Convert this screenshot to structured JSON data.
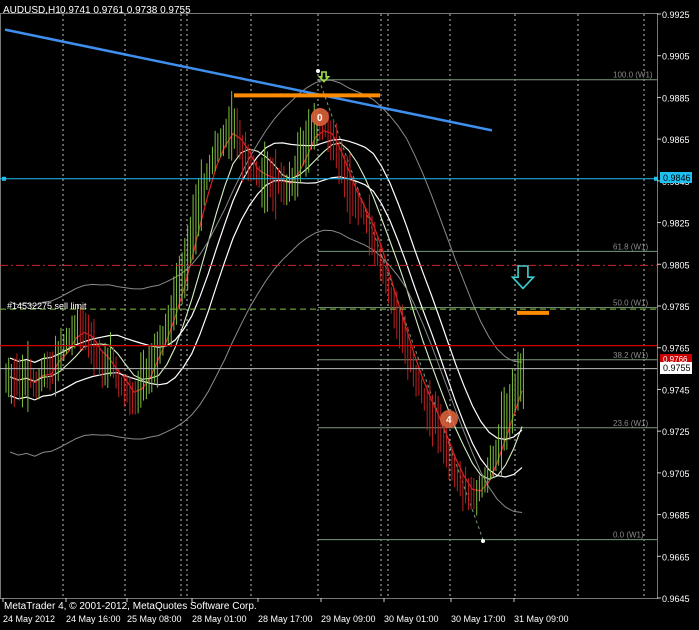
{
  "header": {
    "symbol_tf": "AUDUSD,H1",
    "ohlc": "0.9741 0.9761 0.9738 0.9755"
  },
  "footer": {
    "copyright": "MetaTrader 4, © 2001-2012, MetaQuotes Software Corp."
  },
  "order_label": "#14532275 sell limit",
  "price_badges": {
    "hline": "0.9846",
    "red": "0.9766",
    "current": "0.9755"
  },
  "colors": {
    "background": "#000000",
    "grid": "#ffffff",
    "bull": "#7fbf3f",
    "bear": "#c02020",
    "trendline": "#3f8fef",
    "hline": "#1fbfef",
    "level": "#ff8c00",
    "fibo": "#7a9a7a",
    "red_line": "#cc0000",
    "green_dash": "#7fbf3f",
    "arrow": "#3fcfcf"
  },
  "chart_data": {
    "type": "candlestick",
    "symbol": "AUDUSD",
    "timeframe": "H1",
    "ylim": [
      0.9645,
      0.9925
    ],
    "y_ticks": [
      "0.9925",
      "0.9905",
      "0.9885",
      "0.9865",
      "0.9845",
      "0.9825",
      "0.9805",
      "0.9785",
      "0.9765",
      "0.9745",
      "0.9725",
      "0.9705",
      "0.9685",
      "0.9665",
      "0.9645"
    ],
    "x_ticks": [
      "24 May 2012",
      "24 May 16:00",
      "25 May 08:00",
      "28 May 01:00",
      "28 May 17:00",
      "29 May 09:00",
      "30 May 01:00",
      "30 May 17:00",
      "31 May 09:00"
    ],
    "close_path": [
      0.9751,
      0.9748,
      0.9752,
      0.9745,
      0.9758,
      0.9754,
      0.9764,
      0.977,
      0.9775,
      0.9772,
      0.9764,
      0.9756,
      0.976,
      0.9747,
      0.9743,
      0.9741,
      0.9752,
      0.9759,
      0.9768,
      0.9779,
      0.9792,
      0.9806,
      0.9824,
      0.984,
      0.9852,
      0.9864,
      0.9868,
      0.9871,
      0.9856,
      0.985,
      0.9846,
      0.9848,
      0.9845,
      0.9842,
      0.9845,
      0.986,
      0.9866,
      0.9872,
      0.9869,
      0.9862,
      0.985,
      0.9839,
      0.9832,
      0.9826,
      0.9814,
      0.98,
      0.9786,
      0.9774,
      0.9762,
      0.9748,
      0.974,
      0.9733,
      0.9722,
      0.9711,
      0.9702,
      0.9697,
      0.9692,
      0.97,
      0.971,
      0.972,
      0.9733,
      0.9745,
      0.9755
    ],
    "fibonacci": [
      {
        "label": "100.0 (W1)",
        "price": 0.98935
      },
      {
        "label": "61.8 (W1)",
        "price": 0.98112
      },
      {
        "label": "50.0 (W1)",
        "price": 0.97842
      },
      {
        "label": "38.2 (W1)",
        "price": 0.97592
      },
      {
        "label": "23.6 (W1)",
        "price": 0.97266
      },
      {
        "label": "0.0 (W1)",
        "price": 0.9673
      }
    ],
    "horizontal_line": 0.9846,
    "red_line": 0.9766,
    "current_price": 0.9755,
    "sell_limit_level": 0.97835,
    "resistance_level": 0.9886,
    "target_level": 0.97817,
    "trendline": {
      "from": 0.99175,
      "to": 0.98692
    },
    "red_dashdot_level": 0.98045,
    "markers": [
      "0",
      "4"
    ]
  }
}
